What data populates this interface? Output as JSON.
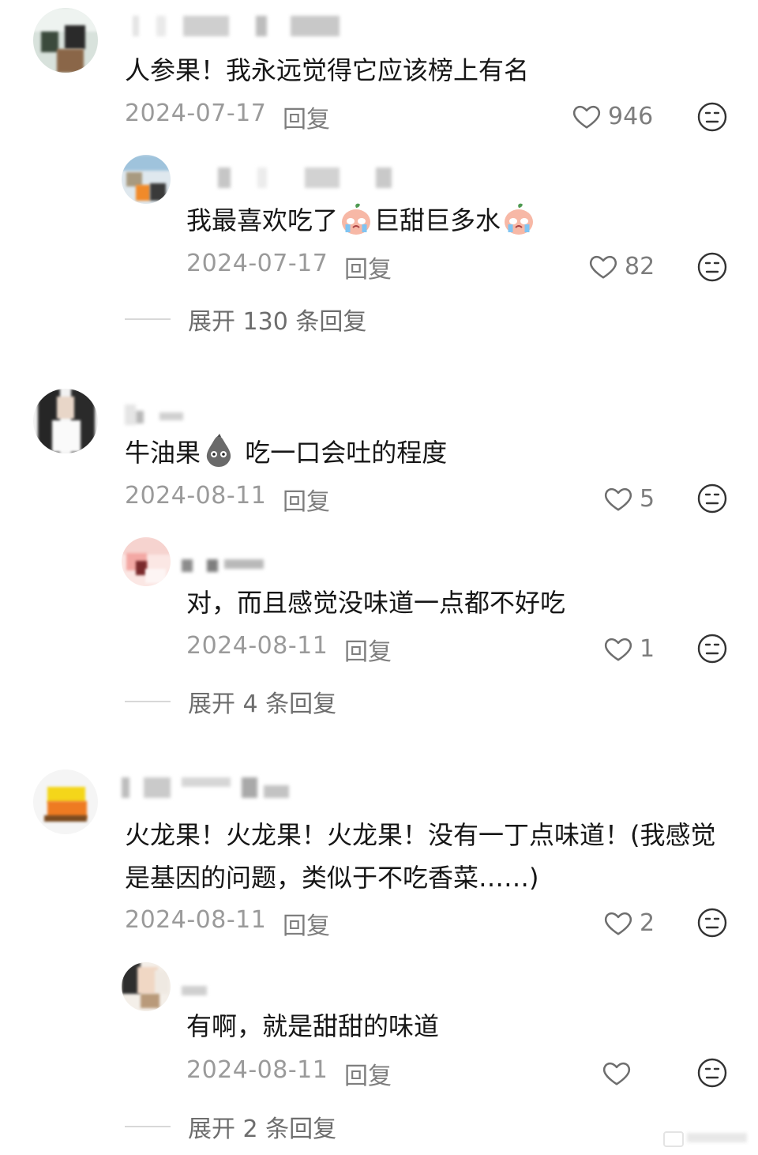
{
  "comments": [
    {
      "text": "人参果！我永远觉得它应该榜上有名",
      "date": "2024-07-17",
      "reply_label": "回复",
      "likes": "946",
      "reply": {
        "text_a": "我最喜欢吃了",
        "text_b": "巨甜巨多水",
        "date": "2024-07-17",
        "reply_label": "回复",
        "likes": "82"
      },
      "expand_label": "展开 130 条回复"
    },
    {
      "text_a": "牛油果",
      "text_b": " 吃一口会吐的程度",
      "date": "2024-08-11",
      "reply_label": "回复",
      "likes": "5",
      "reply": {
        "text": "对，而且感觉没味道一点都不好吃",
        "date": "2024-08-11",
        "reply_label": "回复",
        "likes": "1"
      },
      "expand_label": "展开 4 条回复"
    },
    {
      "text": "火龙果！火龙果！火龙果！没有一丁点味道！(我感觉是基因的问题，类似于不吃香菜……)",
      "date": "2024-08-11",
      "reply_label": "回复",
      "likes": "2",
      "reply": {
        "text": "有啊，就是甜甜的味道",
        "date": "2024-08-11",
        "reply_label": "回复",
        "likes": ""
      },
      "expand_label": "展开 2 条回复"
    }
  ],
  "icons": {
    "like": "heart-outline-icon",
    "dislike": "neutral-face-icon",
    "emoji_crying": "crying-peach-emoji",
    "emoji_avocado": "avocado-face-emoji"
  },
  "colors": {
    "text": "#161616",
    "meta": "#9a9a9a",
    "reply": "#7e7e7e"
  }
}
